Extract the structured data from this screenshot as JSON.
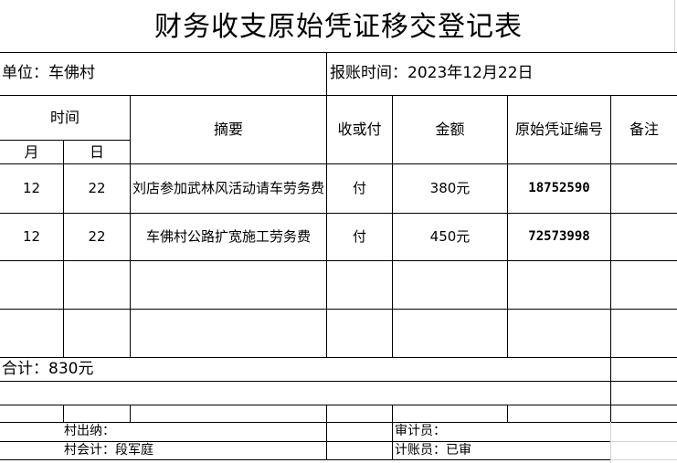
{
  "title": "财务收支原始凭证移交登记表",
  "unit_label": "单位：车佛村",
  "date_label": "报账时间：2023年12月22日",
  "headers": {
    "time": "时间",
    "month": "月",
    "day": "日",
    "summary": "摘要",
    "type": "收或付",
    "amount": "金额",
    "voucher": "原始凭证编号",
    "remark": "备注"
  },
  "rows": [
    {
      "month": "12",
      "day": "22",
      "summary": "刘店参加武林风活动请车劳务费",
      "type": "付",
      "amount": "380元",
      "voucher": "18752590",
      "remark": ""
    },
    {
      "month": "12",
      "day": "22",
      "summary": "车佛村公路扩宽施工劳务费",
      "type": "付",
      "amount": "450元",
      "voucher": "72573998",
      "remark": ""
    }
  ],
  "total_label": "合计：830元",
  "signatures": {
    "cashier": "村出纳：",
    "auditor": "审计员：",
    "accountant": "村会计：段军庭",
    "bookkeeper": "计账员：已审"
  }
}
